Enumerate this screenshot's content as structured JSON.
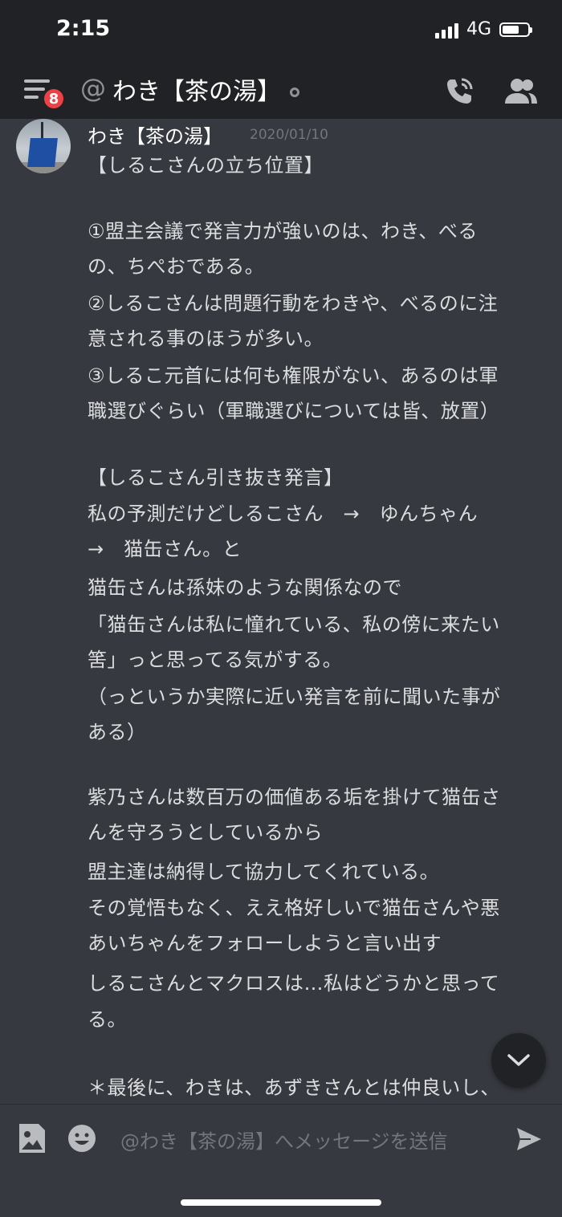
{
  "status_bar": {
    "time": "2:15",
    "network": "4G"
  },
  "header": {
    "badge_count": "8",
    "at_symbol": "@",
    "title": "わき【茶の湯】"
  },
  "message": {
    "author": "わき【茶の湯】",
    "timestamp": "2020/01/10",
    "lines": [
      "【しるこさんの立ち位置】",
      "①盟主会議で発言力が強いのは、わき、べる",
      "の、ちぺおである。",
      "②しるこさんは問題行動をわきや、べるのに注",
      "意される事のほうが多い。",
      "③しるこ元首には何も権限がない、あるのは軍",
      "職選びぐらい（軍職選びについては皆、放置）",
      "【しるこさん引き抜き発言】",
      "私の予測だけどしるこさん　→　ゆんちゃん",
      "→　猫缶さん。と",
      "猫缶さんは孫妹のような関係なので",
      "「猫缶さんは私に憧れている、私の傍に来たい",
      "筈」っと思ってる気がする。",
      "（っというか実際に近い発言を前に聞いた事が",
      "ある）",
      "紫乃さんは数百万の価値ある垢を掛けて猫缶さ",
      "んを守ろうとしているから",
      "盟主達は納得して協力してくれている。",
      "その覚悟もなく、ええ格好しいで猫缶さんや悪",
      "あいちゃんをフォローしようと言い出す",
      "しるこさんとマクロスは…私はどうかと思って",
      "る。",
      "＊最後に、わきは、あずきさんとは仲良いし、"
    ]
  },
  "input": {
    "placeholder": "@わき【茶の湯】へメッセージを送信"
  },
  "colors": {
    "background": "#36393f",
    "header": "#202225",
    "badge": "#ed4245",
    "text": "#dcddde",
    "muted": "#72767d"
  },
  "icons": [
    "menu-icon",
    "at-icon",
    "status-dot",
    "call-icon",
    "members-icon",
    "chevron-down-icon",
    "image-attach-icon",
    "emoji-icon",
    "send-icon"
  ]
}
